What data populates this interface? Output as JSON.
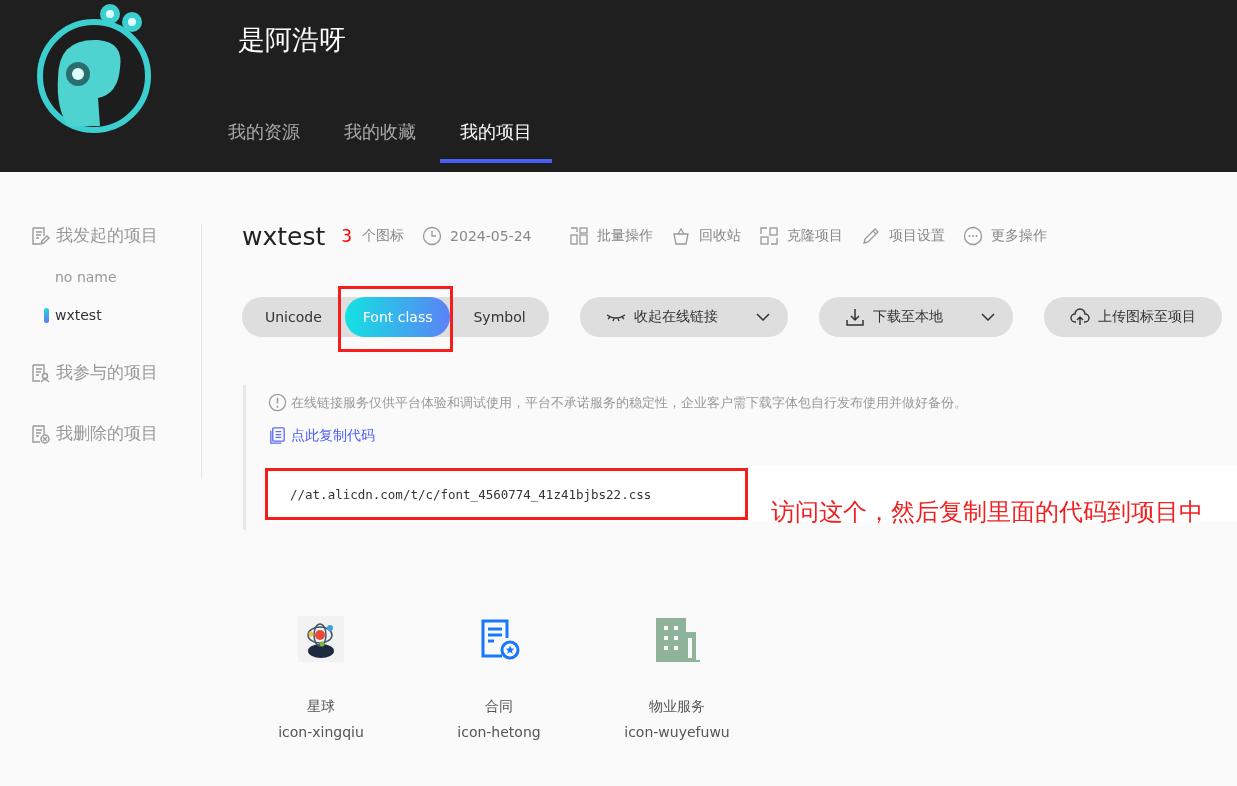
{
  "header": {
    "username": "是阿浩呀",
    "tabs": [
      {
        "label": "我的资源",
        "selected": false
      },
      {
        "label": "我的收藏",
        "selected": false
      },
      {
        "label": "我的项目",
        "selected": true
      }
    ]
  },
  "sidebar": {
    "groups": [
      {
        "kind": "edit",
        "label": "我发起的项目",
        "children": [
          {
            "label": "no name",
            "selected": false
          },
          {
            "label": "wxtest",
            "selected": true
          }
        ]
      },
      {
        "kind": "people",
        "label": "我参与的项目"
      },
      {
        "kind": "trash",
        "label": "我删除的项目"
      }
    ]
  },
  "project": {
    "name": "wxtest",
    "icon_count": "3",
    "icon_count_label": "个图标",
    "date": "2024-05-24",
    "actions": [
      {
        "kind": "batch",
        "label": "批量操作"
      },
      {
        "kind": "recycle",
        "label": "回收站"
      },
      {
        "kind": "clone",
        "label": "克隆项目"
      },
      {
        "kind": "settings",
        "label": "项目设置"
      },
      {
        "kind": "more",
        "label": "更多操作"
      }
    ]
  },
  "format_tabs": [
    {
      "label": "Unicode",
      "selected": false,
      "highlighted": false
    },
    {
      "label": "Font class",
      "selected": true,
      "highlighted": true
    },
    {
      "label": "Symbol",
      "selected": false,
      "highlighted": false
    }
  ],
  "toolbar_buttons": [
    {
      "kind": "collapse",
      "label": "收起在线链接",
      "dropdown": true
    },
    {
      "kind": "download",
      "label": "下载至本地",
      "dropdown": true
    },
    {
      "kind": "upload",
      "label": "上传图标至项目",
      "dropdown": false
    }
  ],
  "notice": {
    "text": "在线链接服务仅供平台体验和调试使用，平台不承诺服务的稳定性，企业客户需下载字体包自行发布使用并做好备份。",
    "copy_link": "点此复制代码",
    "code": "//at.alicdn.com/t/c/font_4560774_41z41bjbs22.css",
    "code_highlighted": true
  },
  "annotation": "访问这个，然后复制里面的代码到项目中",
  "icons": [
    {
      "kind": "planet",
      "name": "星球",
      "class": "icon-xingqiu"
    },
    {
      "kind": "contract",
      "name": "合同",
      "class": "icon-hetong"
    },
    {
      "kind": "building",
      "name": "物业服务",
      "class": "icon-wuyefuwu"
    }
  ]
}
